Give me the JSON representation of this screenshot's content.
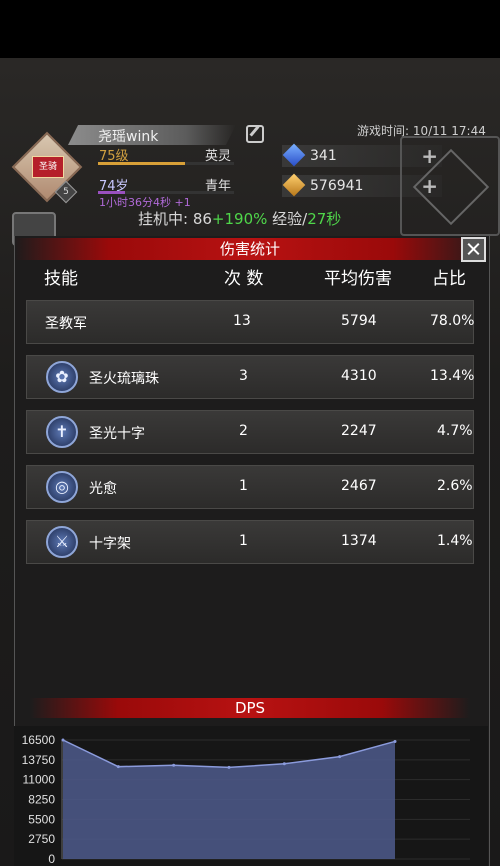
{
  "hud": {
    "player_name": "尧瑶wink",
    "level": "75级",
    "class": "英灵",
    "age": "74岁",
    "stage": "青年",
    "timer": "1小时36分4秒 +1",
    "avatar_name": "圣骑",
    "avatar_level": "5",
    "game_time": "游戏时间: 10/11 17:44",
    "gem_blue": "341",
    "gem_gold": "576941",
    "idle_label": "挂机中: 86",
    "idle_bonus": "+190%",
    "exp_label": " 经验/",
    "exp_rate": "27秒"
  },
  "panel": {
    "title": "伤害统计",
    "headers": {
      "skill": "技能",
      "count": "次 数",
      "avg": "平均伤害",
      "share": "占比"
    },
    "rows": [
      {
        "skill": "圣教军",
        "count": "13",
        "avg": "5794",
        "share": "78.0%",
        "icon": ""
      },
      {
        "skill": "圣火琉璃珠",
        "count": "3",
        "avg": "4310",
        "share": "13.4%",
        "icon": "orb-icon"
      },
      {
        "skill": "圣光十字",
        "count": "2",
        "avg": "2247",
        "share": "4.7%",
        "icon": "cross-icon"
      },
      {
        "skill": "光愈",
        "count": "1",
        "avg": "2467",
        "share": "2.6%",
        "icon": "heal-icon"
      },
      {
        "skill": "十字架",
        "count": "1",
        "avg": "1374",
        "share": "1.4%",
        "icon": "sword-icon"
      }
    ]
  },
  "chart_data": {
    "type": "area",
    "title": "DPS",
    "xlabel": "",
    "ylabel": "",
    "y_ticks": [
      "16500",
      "13750",
      "11000",
      "8250",
      "5500",
      "2750",
      "0"
    ],
    "ylim": [
      0,
      16500
    ],
    "x": [
      0,
      1,
      2,
      3,
      4,
      5,
      6
    ],
    "values": [
      16500,
      12800,
      13000,
      12700,
      13200,
      14200,
      16300
    ],
    "colors": {
      "fill": "#4d5a8c",
      "line": "#8b9bdc"
    }
  }
}
